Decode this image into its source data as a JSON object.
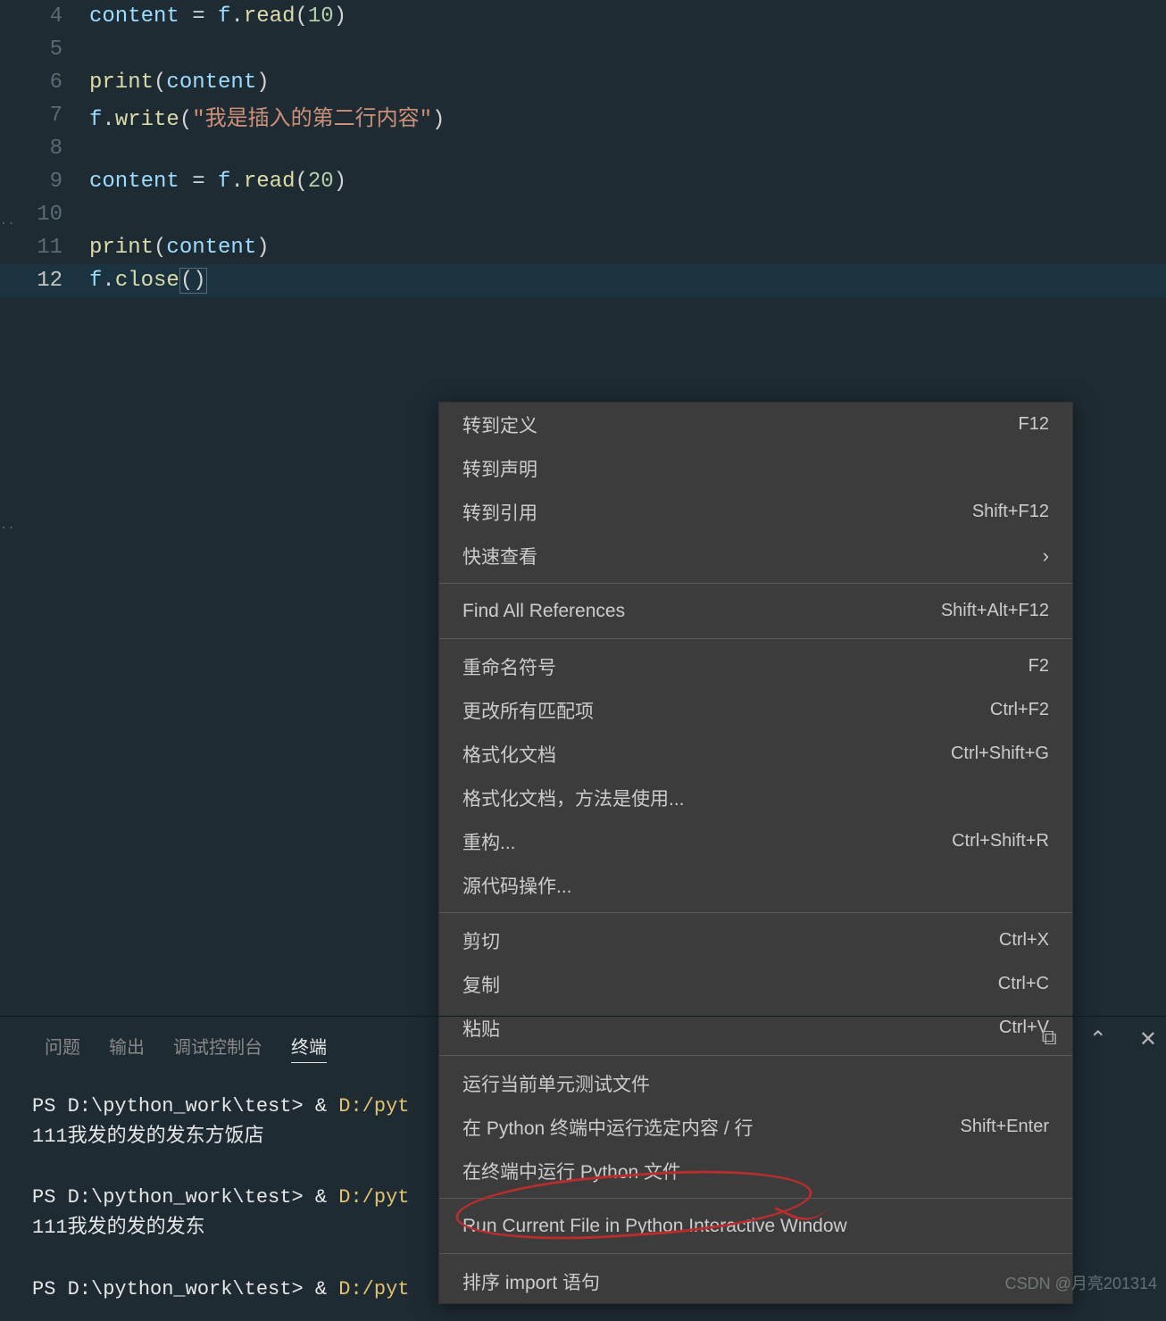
{
  "code": {
    "lines": [
      {
        "n": "4",
        "html": "<span class='var'>content</span> <span class='punc'>=</span> <span class='var'>f</span><span class='punc'>.</span><span class='fn'>read</span><span class='punc'>(</span><span class='num'>10</span><span class='punc'>)</span>"
      },
      {
        "n": "5",
        "html": ""
      },
      {
        "n": "6",
        "html": "<span class='fn'>print</span><span class='punc'>(</span><span class='var'>content</span><span class='punc'>)</span>"
      },
      {
        "n": "7",
        "html": "<span class='var'>f</span><span class='punc'>.</span><span class='fn'>write</span><span class='punc'>(</span><span class='str'>\"我是插入的第二行内容\"</span><span class='punc'>)</span>"
      },
      {
        "n": "8",
        "html": ""
      },
      {
        "n": "9",
        "html": "<span class='var'>content</span> <span class='punc'>=</span> <span class='var'>f</span><span class='punc'>.</span><span class='fn'>read</span><span class='punc'>(</span><span class='num'>20</span><span class='punc'>)</span>"
      },
      {
        "n": "10",
        "html": ""
      },
      {
        "n": "11",
        "html": "<span class='fn'>print</span><span class='punc'>(</span><span class='var'>content</span><span class='punc'>)</span>"
      },
      {
        "n": "12",
        "html": "<span class='var'>f</span><span class='punc'>.</span><span class='fn'>close</span><span class='punc cursor-bracket'>()</span>",
        "active": true
      }
    ]
  },
  "menu": {
    "items": [
      {
        "label": "转到定义",
        "shortcut": "F12"
      },
      {
        "label": "转到声明",
        "shortcut": ""
      },
      {
        "label": "转到引用",
        "shortcut": "Shift+F12"
      },
      {
        "label": "快速查看",
        "chevron": true
      },
      {
        "sep": true
      },
      {
        "label": "Find All References",
        "shortcut": "Shift+Alt+F12"
      },
      {
        "sep": true
      },
      {
        "label": "重命名符号",
        "shortcut": "F2"
      },
      {
        "label": "更改所有匹配项",
        "shortcut": "Ctrl+F2"
      },
      {
        "label": "格式化文档",
        "shortcut": "Ctrl+Shift+G"
      },
      {
        "label": "格式化文档，方法是使用...",
        "shortcut": ""
      },
      {
        "label": "重构...",
        "shortcut": "Ctrl+Shift+R"
      },
      {
        "label": "源代码操作...",
        "shortcut": ""
      },
      {
        "sep": true
      },
      {
        "label": "剪切",
        "shortcut": "Ctrl+X"
      },
      {
        "label": "复制",
        "shortcut": "Ctrl+C"
      },
      {
        "label": "粘贴",
        "shortcut": "Ctrl+V"
      },
      {
        "sep": true
      },
      {
        "label": "运行当前单元测试文件",
        "shortcut": ""
      },
      {
        "label": "在 Python 终端中运行选定内容 / 行",
        "shortcut": "Shift+Enter"
      },
      {
        "label": "在终端中运行 Python 文件",
        "shortcut": ""
      },
      {
        "sep": true
      },
      {
        "label": "Run Current File in Python Interactive Window",
        "shortcut": ""
      },
      {
        "sep": true
      },
      {
        "label": "排序 import 语句",
        "shortcut": ""
      }
    ]
  },
  "panel": {
    "tabs": [
      "问题",
      "输出",
      "调试控制台",
      "终端"
    ],
    "active_tab": "终端"
  },
  "terminal": {
    "lines": [
      {
        "prompt": "PS D:\\python_work\\test>",
        "cmd": " & ",
        "path": "D:/pyt"
      },
      {
        "out": "111我发的发的发东方饭店"
      },
      {
        "blank": true
      },
      {
        "prompt": "PS D:\\python_work\\test>",
        "cmd": " & ",
        "path": "D:/pyt"
      },
      {
        "out": "111我发的发的发东"
      },
      {
        "blank": true
      },
      {
        "prompt": "PS D:\\python_work\\test>",
        "cmd": " & ",
        "path": "D:/pyt"
      }
    ]
  },
  "toolbar": {
    "icon1": "⧉",
    "icon2": "⌃",
    "icon3": "✕"
  },
  "watermark": "CSDN @月亮201314"
}
